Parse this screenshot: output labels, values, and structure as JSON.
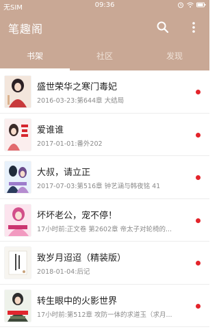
{
  "status_bar": {
    "carrier": "无SIM",
    "time": "09:36",
    "icons": [
      "alarm-icon",
      "wifi-icon",
      "battery-icon"
    ]
  },
  "app_bar": {
    "title": "笔趣阁",
    "icons": [
      "search-icon",
      "more-vert-icon"
    ]
  },
  "tabs": [
    {
      "label": "书架",
      "active": true
    },
    {
      "label": "社区",
      "active": false
    },
    {
      "label": "发现",
      "active": false
    }
  ],
  "books": [
    {
      "title": "盛世荣华之寒门毒妃",
      "meta": "2016-03-23:第644章 大结局",
      "unread": true
    },
    {
      "title": "爱谁谁",
      "meta": "2017-01-01:番外202",
      "unread": true
    },
    {
      "title": "大叔，请立正",
      "meta": "2017-07-03:第516章 钟艺涵与韩夜铭 41",
      "unread": true
    },
    {
      "title": "坏坏老公，宠不停！",
      "meta": "17小时前:正文卷 第2602章 帝太子对轮椅的...",
      "unread": true
    },
    {
      "title": "致岁月迢迢（精装版）",
      "meta": "2018-01-04:后记",
      "unread": true
    },
    {
      "title": "转生眼中的火影世界",
      "meta": "17小时前:第512章 攻防一体的求道玉（求月...",
      "unread": true
    }
  ],
  "colors": {
    "primary": "#c9a895",
    "unread_dot": "#e3242b",
    "title_text": "#222222",
    "meta_text": "#8a8a8a"
  }
}
